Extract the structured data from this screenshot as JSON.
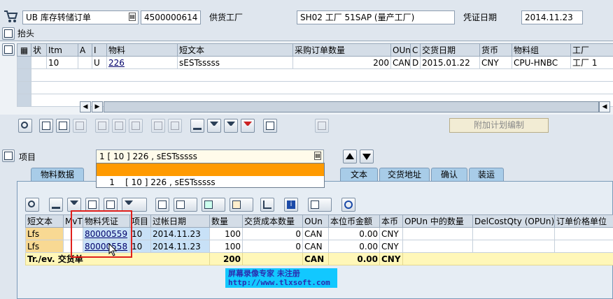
{
  "header": {
    "doc_type": "UB 库存转储订单",
    "po_number": "4500000614",
    "vendor_plant_label": "供货工厂",
    "vendor_plant": "SH02 工厂 51SAP (量产工厂)",
    "doc_date_label": "凭证日期",
    "doc_date": "2014.11.23"
  },
  "header_section_label": "抬头",
  "items_table": {
    "columns": [
      "状",
      "Itm",
      "A",
      "I",
      "物料",
      "短文本",
      "采购订单数量",
      "OUn",
      "C",
      "交货日期",
      "货币",
      "物料组",
      "工厂"
    ],
    "rows": [
      {
        "status": "",
        "itm": "10",
        "a": "",
        "i": "U",
        "material": "226",
        "short_text": "sESTsssss",
        "qty": "200",
        "oun": "CAN",
        "c": "D",
        "delivery_date": "2015.01.22",
        "currency": "CNY",
        "material_group": "CPU-HNBC",
        "plant": "工厂 1"
      }
    ]
  },
  "plan_button_label": "附加计划编制",
  "item_section": {
    "label": "项目",
    "selected": "1 [ 10 ] 226 , sESTsssss",
    "dropdown_option": "1    [ 10 ] 226 , sESTsssss"
  },
  "tabs": [
    "物料数据",
    "文本",
    "交货地址",
    "确认",
    "装运"
  ],
  "history_table": {
    "columns": [
      "短文本",
      "MvT",
      "物料凭证",
      "项目",
      "过帐日期",
      "数量",
      "交货成本数量",
      "OUn",
      "本位币金额",
      "本币",
      "OPUn 中的数量",
      "DelCostQty (OPUn)",
      "订单价格单位"
    ],
    "rows": [
      {
        "short_text": "Lfs",
        "mvt": "",
        "doc": "80000559",
        "item": "10",
        "date": "2014.11.23",
        "qty": "100",
        "dcq": "0",
        "oun": "CAN",
        "amount": "0.00",
        "cur": "CNY"
      },
      {
        "short_text": "Lfs",
        "mvt": "",
        "doc": "80000558",
        "item": "10",
        "date": "2014.11.23",
        "qty": "100",
        "dcq": "0",
        "oun": "CAN",
        "amount": "0.00",
        "cur": "CNY"
      }
    ],
    "summary": {
      "label": "Tr./ev. 交货单",
      "qty": "200",
      "oun": "CAN",
      "amount": "0.00",
      "cur": "CNY"
    }
  },
  "watermark": {
    "line1": "屏幕录像专家      未注册",
    "line2": "http://www.tlxsoft.com"
  },
  "colors": {
    "background": "#dfe6ee",
    "highlight_box": "#e0201c",
    "dropdown_selected": "#ff9a00",
    "summary_row": "#fff7b8"
  }
}
